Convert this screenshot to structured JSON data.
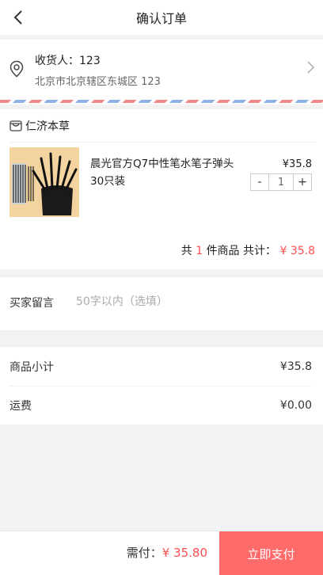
{
  "header": {
    "title": "确认订单"
  },
  "address": {
    "name_label": "收货人：123",
    "detail": "北京市北京辖区东城区 123"
  },
  "shop": {
    "name": "仁济本草"
  },
  "product": {
    "title": "晨光官方Q7中性笔水笔子弹头30只装",
    "price": "¥35.8",
    "qty": "1",
    "minus": "-",
    "plus": "+"
  },
  "summary": {
    "prefix": "共",
    "count": "1",
    "middle": "件商品 共计：",
    "total": "¥ 35.8"
  },
  "memo": {
    "label": "买家留言",
    "placeholder": "50字以内（选填）"
  },
  "totals": {
    "subtotal_label": "商品小计",
    "subtotal_value": "¥35.8",
    "shipping_label": "运费",
    "shipping_value": "¥0.00"
  },
  "footer": {
    "due_label": "需付：",
    "due_value": "¥ 35.80",
    "pay_label": "立即支付"
  }
}
